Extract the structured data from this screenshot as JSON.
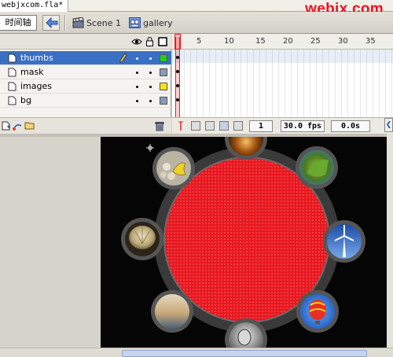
{
  "document": {
    "tab_title": "webjxcom.fla*"
  },
  "watermark": "webjx.com",
  "editbar": {
    "timeline_label": "时间轴",
    "breadcrumbs": [
      {
        "label": "Scene 1",
        "icon": "scene-clapper-icon"
      },
      {
        "label": "gallery",
        "icon": "movieclip-symbol-icon"
      }
    ]
  },
  "timeline": {
    "header_icons": [
      "eye-icon",
      "lock-icon",
      "outline-square-icon"
    ],
    "ruler_ticks": [
      "1",
      "5",
      "10",
      "15",
      "20",
      "25",
      "30",
      "35"
    ],
    "layers": [
      {
        "name": "thumbs",
        "selected": true,
        "outline_color": "#22cc22"
      },
      {
        "name": "mask",
        "selected": false,
        "outline_color": "#8899bb"
      },
      {
        "name": "images",
        "selected": false,
        "outline_color": "#f5e21b"
      },
      {
        "name": "bg",
        "selected": false,
        "outline_color": "#8899bb"
      }
    ],
    "current_frame": "1",
    "frame_rate": "30.0 fps",
    "elapsed_time": "0.0s"
  },
  "stage": {
    "center_fill": "#e8171f",
    "thumbnails": [
      {
        "name": "thumb-orange-sunset"
      },
      {
        "name": "thumb-green-fabric"
      },
      {
        "name": "thumb-wind-turbine"
      },
      {
        "name": "thumb-hot-air-balloon"
      },
      {
        "name": "thumb-portrait-bw"
      },
      {
        "name": "thumb-sea-sunset"
      },
      {
        "name": "thumb-sea-urchin"
      },
      {
        "name": "thumb-yellow-lizard"
      }
    ]
  }
}
